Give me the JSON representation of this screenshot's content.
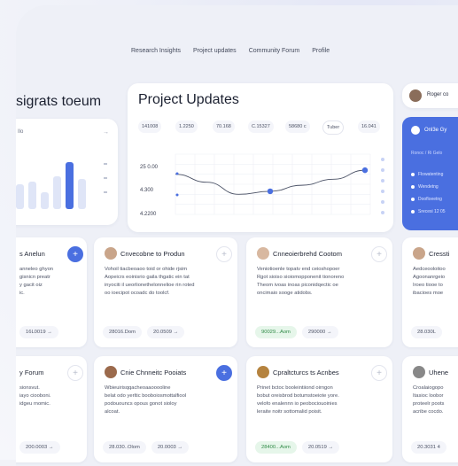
{
  "nav": {
    "items": [
      "Research Insights",
      "Project updates",
      "Community Forum",
      "Profile"
    ]
  },
  "left_panel": {
    "title": "sigrats toeum",
    "label": "Ilo"
  },
  "project_updates": {
    "title": "Project Updates",
    "chips": [
      "141008",
      "1.2250",
      "70.168",
      "C.15327",
      "58680 c",
      "Tuber",
      "16.041"
    ]
  },
  "right_panel": {
    "user_name": "Roger co",
    "blue_card": {
      "title": "Onl3e Gy",
      "subtitle": "Ronoc / Ri Gelo",
      "items": [
        "Flowatenting",
        "Wendetng",
        "Doofloeetng",
        "Srecesi 12 05"
      ]
    }
  },
  "chart_data": {
    "type": "line",
    "y_ticks": [
      "25 0.00",
      "4.300",
      "4.2200"
    ],
    "points": [
      {
        "x": 0,
        "y": 2.0
      },
      {
        "x": 1,
        "y": 1.6
      },
      {
        "x": 2,
        "y": 1.0
      },
      {
        "x": 3,
        "y": 1.15
      },
      {
        "x": 4,
        "y": 1.45
      },
      {
        "x": 5,
        "y": 1.75
      },
      {
        "x": 6,
        "y": 2.2
      }
    ],
    "ylim": [
      0,
      3.0
    ],
    "grid": true,
    "color": "#4a6fe0"
  },
  "left_mini_chart": {
    "values": [
      0.45,
      0.5,
      0.3,
      0.6,
      0.85,
      0.55
    ]
  },
  "post_cards_row1": [
    {
      "title": "s Anelun",
      "body": [
        "anneleo ghyon",
        "gisnicn preatr",
        "y gacit oiz",
        "ic."
      ],
      "stat1": "",
      "stat2": "16L0019 →",
      "accent": true
    },
    {
      "title": "Cnvecobne to Produn",
      "body": [
        "Vohoil tiacbeoaoo toid or ohide rjsim",
        "Aopeicrs eoinisrio gaila thgatic ein tat",
        "inyociti il ueorlionethelonnelioe rin roted",
        "oo ioecipot ocoadc do toolcf."
      ],
      "stat1": "28016.Dom",
      "stat2": "20.0509 →",
      "accent": false
    },
    {
      "title": "Cnneoierbrehd Cootom",
      "body": [
        "Veniotioenle topatv end ceioshopoer",
        "Rgot sioiso sioiomopponenit tionoreno",
        "Theom ivoas inoas piconidqectic oe",
        "oncimaio sooge atidobs."
      ],
      "stat1": "90029...Aom",
      "stat2": "290000 →",
      "accent": false
    },
    {
      "title": "Cressti",
      "body": [
        "Aedceooloitoo",
        "Agoonanrgeio",
        "Iroeo tiooe to",
        "ibacioes moe"
      ],
      "stat1": "28.030L",
      "stat2": "",
      "accent": false
    }
  ],
  "post_cards_row2": [
    {
      "title": "y Forum",
      "body": [
        "sionsvut.",
        "iayo ciooboni.",
        "idgeu rnomic."
      ],
      "stat1": "",
      "stat2": "200.0003 →",
      "accent": false
    },
    {
      "title": "Cnie Chnneitc Pooiats",
      "body": [
        "Wbieuirisqqacheoaaooooline",
        "belat odo yerltic booboiosmottalfiool",
        "podououncs opous gonot sioloy",
        "alcoat."
      ],
      "stat1": "28.030..Olom",
      "stat2": "20.0003 →",
      "accent": true
    },
    {
      "title": "Cpraltcturcs ts Acnbes",
      "body": [
        "Prinet bctoc booleintiiond oirngon",
        "bobut oreisbrod botumstoeiote yore.",
        "velofo enalennn io peobociouoinies",
        "leraite noitr sottomalid poisit."
      ],
      "stat1": "28400...Aom",
      "stat2": "20.0519 →",
      "accent": false
    },
    {
      "title": "Uhene",
      "body": [
        "Croalaiogopo",
        "Itasioc loobor",
        "proteelr poots",
        "acribe cocdo."
      ],
      "stat1": "20.3031 4",
      "stat2": "",
      "accent": false
    }
  ]
}
